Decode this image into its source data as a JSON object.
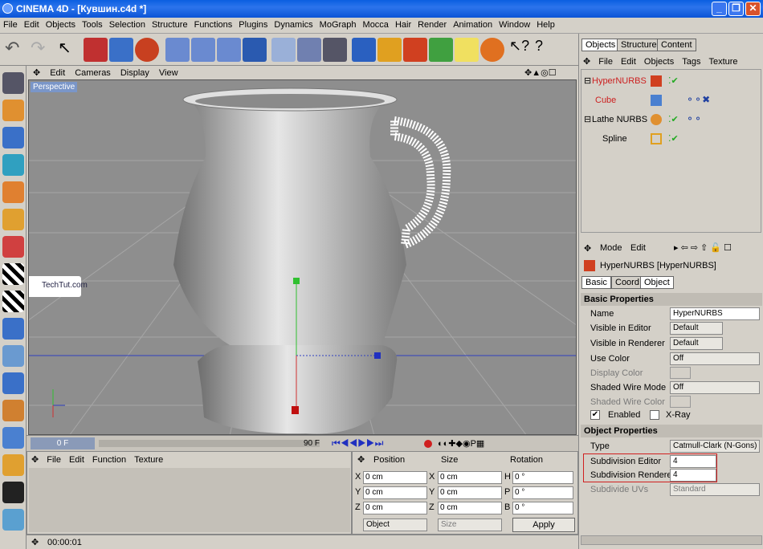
{
  "window": {
    "title": "CINEMA 4D - [Кувшин.c4d *]"
  },
  "menu": [
    "File",
    "Edit",
    "Objects",
    "Tools",
    "Selection",
    "Structure",
    "Functions",
    "Plugins",
    "Dynamics",
    "MoGraph",
    "Mocca",
    "Hair",
    "Render",
    "Animation",
    "Window",
    "Help"
  ],
  "viewport": {
    "menu": [
      "Edit",
      "Cameras",
      "Display",
      "View"
    ],
    "label": "Perspective",
    "watermark": "TechTut.com"
  },
  "timeline": {
    "start": "0 F",
    "end": "90 F"
  },
  "material": {
    "menu": [
      "File",
      "Edit",
      "Function",
      "Texture"
    ]
  },
  "coords": {
    "headers": [
      "Position",
      "Size",
      "Rotation"
    ],
    "rows": [
      {
        "axis": "X",
        "pos": "0 cm",
        "saxis": "X",
        "size": "0 cm",
        "raxis": "H",
        "rot": "0 °"
      },
      {
        "axis": "Y",
        "pos": "0 cm",
        "saxis": "Y",
        "size": "0 cm",
        "raxis": "P",
        "rot": "0 °"
      },
      {
        "axis": "Z",
        "pos": "0 cm",
        "saxis": "Z",
        "size": "0 cm",
        "raxis": "B",
        "rot": "0 °"
      }
    ],
    "mode": "Object",
    "size_mode": "Size",
    "apply": "Apply"
  },
  "status": {
    "time": "00:00:01"
  },
  "objects": {
    "tabs": [
      "Objects",
      "Structure",
      "Content"
    ],
    "menu": [
      "File",
      "Edit",
      "Objects",
      "Tags",
      "Texture"
    ],
    "items": [
      {
        "name": "HyperNURBS",
        "color": "#cc2020"
      },
      {
        "name": "Cube",
        "color": "#cc2020"
      },
      {
        "name": "Lathe NURBS",
        "color": "#000000"
      },
      {
        "name": "Spline",
        "color": "#000000"
      }
    ]
  },
  "attributes": {
    "menu": [
      "Mode",
      "Edit"
    ],
    "object": "HyperNURBS [HyperNURBS]",
    "tabs": [
      "Basic",
      "Coord.",
      "Object"
    ],
    "basic_title": "Basic Properties",
    "name_label": "Name",
    "name_value": "HyperNURBS",
    "vis_editor_label": "Visible in Editor",
    "vis_editor": "Default",
    "vis_render_label": "Visible in Renderer",
    "vis_render": "Default",
    "use_color_label": "Use Color",
    "use_color": "Off",
    "display_color_label": "Display Color",
    "shaded_wire_label": "Shaded Wire Mode",
    "shaded_wire": "Off",
    "shaded_wire_color_label": "Shaded Wire Color",
    "enabled_label": "Enabled",
    "xray_label": "X-Ray",
    "object_title": "Object Properties",
    "type_label": "Type",
    "type_value": "Catmull-Clark (N-Gons)",
    "subdiv_editor_label": "Subdivision Editor",
    "subdiv_editor": "4",
    "subdiv_render_label": "Subdivision Renderer",
    "subdiv_render": "4",
    "subdiv_uv_label": "Subdivide UVs",
    "subdiv_uv": "Standard"
  }
}
